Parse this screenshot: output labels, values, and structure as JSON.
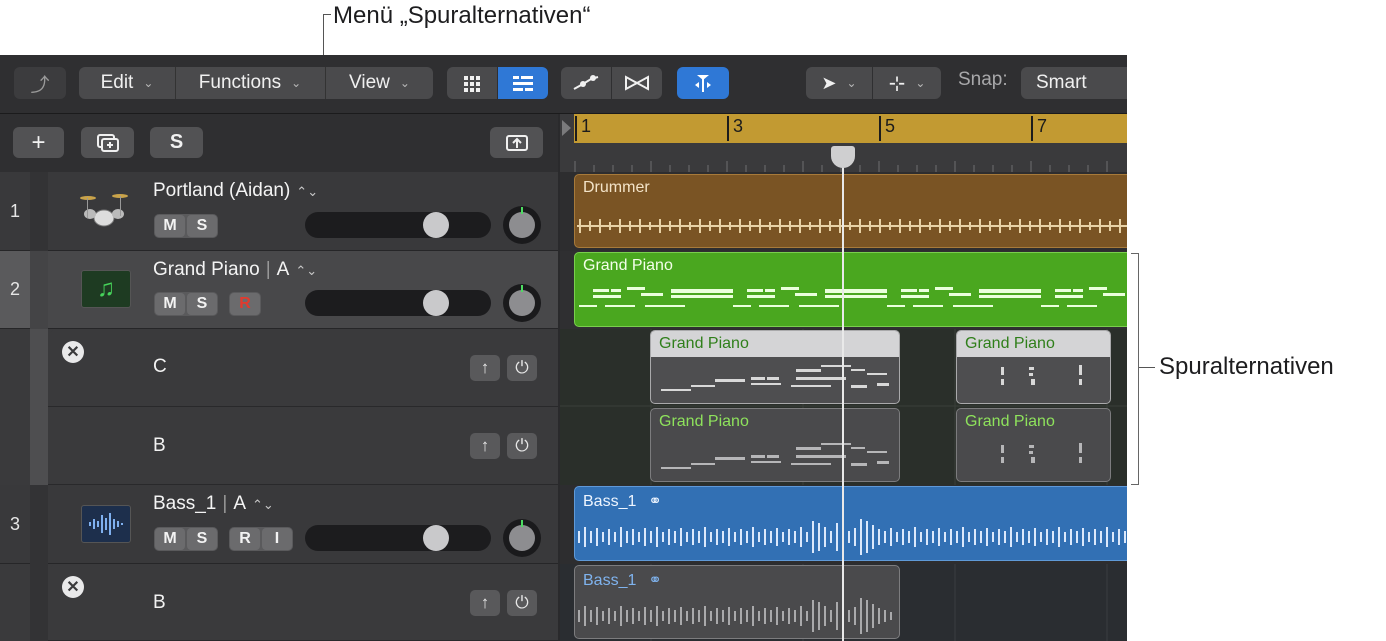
{
  "callouts": {
    "menu": "Menü „Spuralternativen“",
    "alternatives": "Spuralternativen"
  },
  "toolbar": {
    "edit": "Edit",
    "functions": "Functions",
    "view": "View",
    "snap_label": "Snap:",
    "snap_value": "Smart"
  },
  "header": {
    "add": "+",
    "solo": "S"
  },
  "ruler": [
    "1",
    "3",
    "5",
    "7"
  ],
  "tracks": [
    {
      "number": "1",
      "name": "Portland (Aidan)",
      "buttons": [
        "M",
        "S"
      ]
    },
    {
      "number": "2",
      "name": "Grand Piano",
      "alt": "A",
      "buttons": [
        "M",
        "S",
        "R"
      ]
    },
    {
      "number": "3",
      "name": "Bass_1",
      "alt": "A",
      "buttons": [
        "M",
        "S",
        "R",
        "I"
      ]
    }
  ],
  "alternatives": [
    {
      "name": "C"
    },
    {
      "name": "B"
    },
    {
      "name": "B"
    }
  ],
  "regions": {
    "drummer": "Drummer",
    "piano": "Grand Piano",
    "bass": "Bass_1"
  },
  "colors": {
    "drummer": "#7a5424",
    "piano_green": "#4aa71f",
    "bass_blue": "#3270b4",
    "ruler_gold": "#c29a32",
    "accent_blue": "#2f78d6"
  }
}
